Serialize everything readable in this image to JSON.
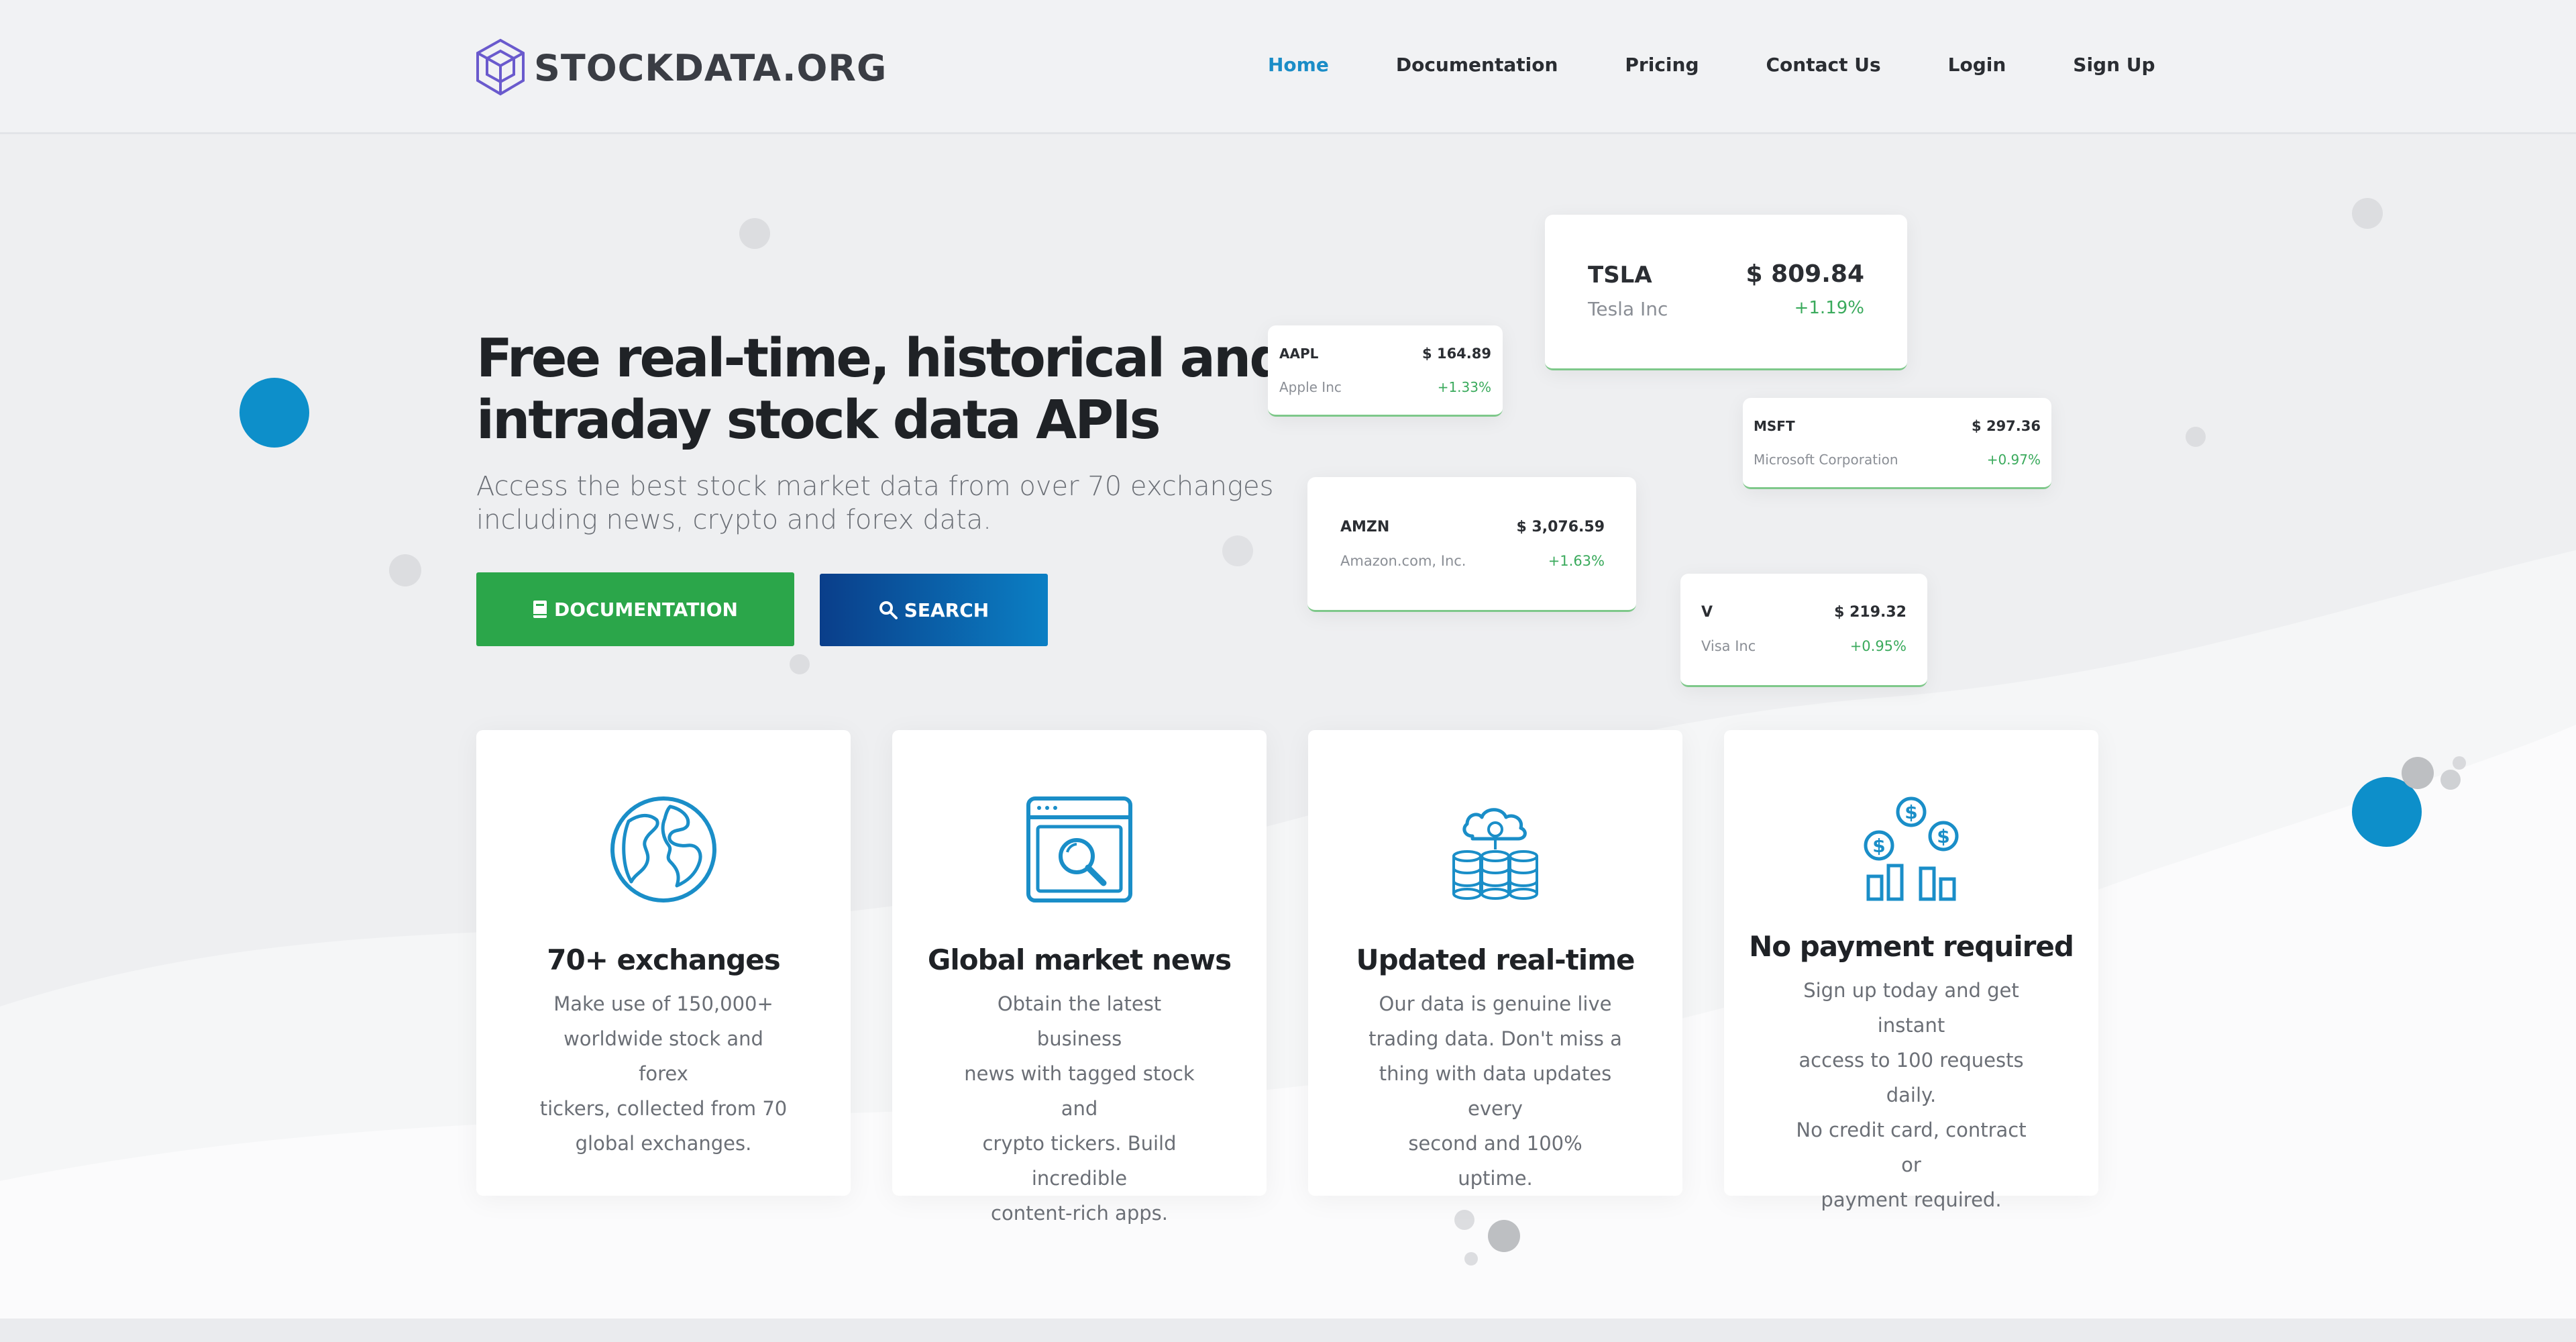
{
  "brand": {
    "name": "STOCKDATA.ORG"
  },
  "nav": [
    {
      "label": "Home",
      "active": true
    },
    {
      "label": "Documentation"
    },
    {
      "label": "Pricing"
    },
    {
      "label": "Contact Us"
    },
    {
      "label": "Login"
    },
    {
      "label": "Sign Up"
    }
  ],
  "hero": {
    "title_line1": "Free real-time, historical and",
    "title_line2": "intraday stock data APIs",
    "subtitle_line1": "Access the best stock market data from over 70 exchanges",
    "subtitle_line2": "including news, crypto and forex data.",
    "doc_button": "DOCUMENTATION",
    "search_button": "SEARCH"
  },
  "stocks": [
    {
      "symbol": "TSLA",
      "price": "$ 809.84",
      "name": "Tesla Inc",
      "change": "+1.19%"
    },
    {
      "symbol": "AAPL",
      "price": "$ 164.89",
      "name": "Apple Inc",
      "change": "+1.33%"
    },
    {
      "symbol": "MSFT",
      "price": "$ 297.36",
      "name": "Microsoft Corporation",
      "change": "+0.97%"
    },
    {
      "symbol": "AMZN",
      "price": "$ 3,076.59",
      "name": "Amazon.com, Inc.",
      "change": "+1.63%"
    },
    {
      "symbol": "V",
      "price": "$ 219.32",
      "name": "Visa Inc",
      "change": "+0.95%"
    }
  ],
  "features": [
    {
      "title": "70+ exchanges",
      "desc": [
        "Make use of 150,000+",
        "worldwide stock and forex",
        "tickers, collected from 70",
        "global exchanges."
      ],
      "icon": "globe-icon"
    },
    {
      "title": "Global market news",
      "desc": [
        "Obtain the latest business",
        "news with tagged stock and",
        "crypto tickers. Build incredible",
        "content-rich apps."
      ],
      "icon": "browser-search-icon"
    },
    {
      "title": "Updated real-time",
      "desc": [
        "Our data is genuine live",
        "trading data. Don't miss a",
        "thing with data updates every",
        "second and 100% uptime."
      ],
      "icon": "cloud-database-icon"
    },
    {
      "title": "No payment required",
      "desc": [
        "Sign up today and get instant",
        "access to 100 requests daily.",
        "No credit card, contract or",
        "payment required."
      ],
      "icon": "coins-chart-icon"
    }
  ],
  "colors": {
    "accent_blue": "#1b8dc7",
    "doc_green": "#2ba64a",
    "icon_blue": "#1a8ec8",
    "change_green": "#3aaa5c"
  }
}
